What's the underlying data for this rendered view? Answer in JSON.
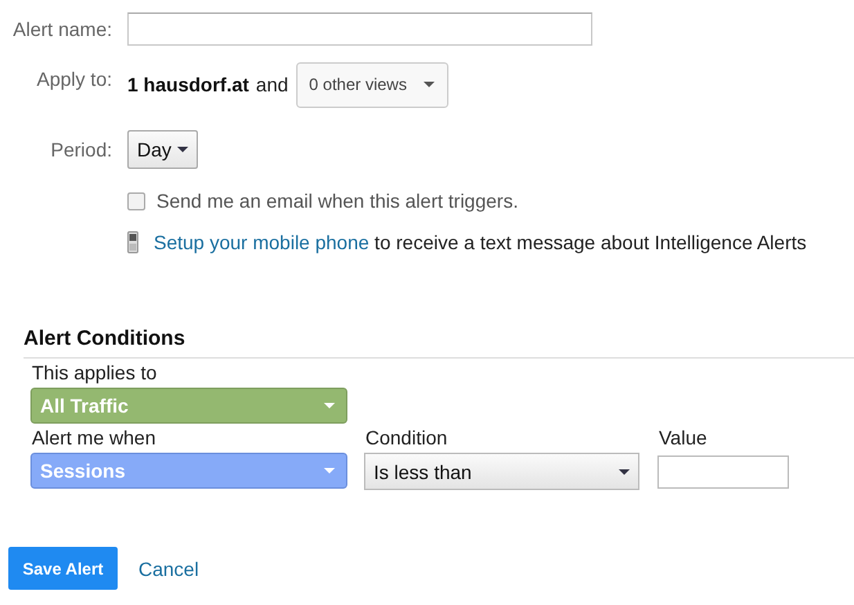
{
  "form": {
    "alert_name": {
      "label": "Alert name:"
    },
    "apply_to": {
      "label": "Apply to:",
      "view": "1 hausdorf.at",
      "joiner": "and",
      "views_dropdown": "0 other views"
    },
    "period": {
      "label": "Period:",
      "value": "Day"
    },
    "email": {
      "label": "Send me an email when this alert triggers.",
      "checked": false
    },
    "mobile": {
      "link": "Setup your mobile phone",
      "text": "to receive a text message about Intelligence Alerts"
    }
  },
  "conditions": {
    "title": "Alert Conditions",
    "applies_label": "This applies to",
    "applies_value": "All Traffic",
    "columns": [
      {
        "label": "Alert me when",
        "kind": "metric",
        "value": "Sessions"
      },
      {
        "label": "Condition",
        "kind": "select",
        "value": "Is less than"
      },
      {
        "label": "Value",
        "kind": "input"
      }
    ]
  },
  "buttons": {
    "save": "Save Alert",
    "cancel": "Cancel"
  }
}
